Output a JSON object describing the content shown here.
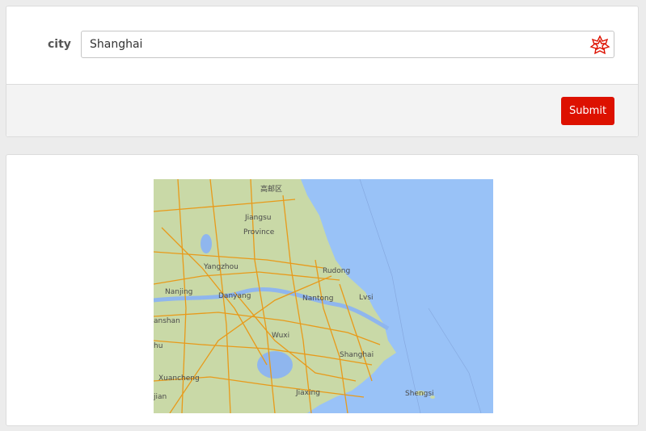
{
  "form": {
    "city_label": "city",
    "city_value": "Shanghai",
    "submit_label": "Submit"
  },
  "map": {
    "labels": {
      "gaoyou": "高邮区",
      "jiangsu": "Jiangsu",
      "province": "Province",
      "yangzhou": "Yangzhou",
      "rudong": "Rudong",
      "nanjing": "Nanjing",
      "danyang": "Danyang",
      "nantong": "Nantong",
      "lvsi": "Lvsi",
      "anshan": "anshan",
      "wuxi": "Wuxi",
      "shanghai": "Shanghai",
      "hu": "hu",
      "xuancheng": "Xuancheng",
      "jiaxing": "Jiaxing",
      "shengsi": "Shengsi",
      "jian": "jian"
    },
    "colors": {
      "sea": "#99c2f7",
      "land": "#c9d9a7",
      "road": "#e89a1a",
      "lake": "#8fb6ee"
    }
  },
  "icons": {
    "input_icon": "wolfram-star-icon"
  }
}
